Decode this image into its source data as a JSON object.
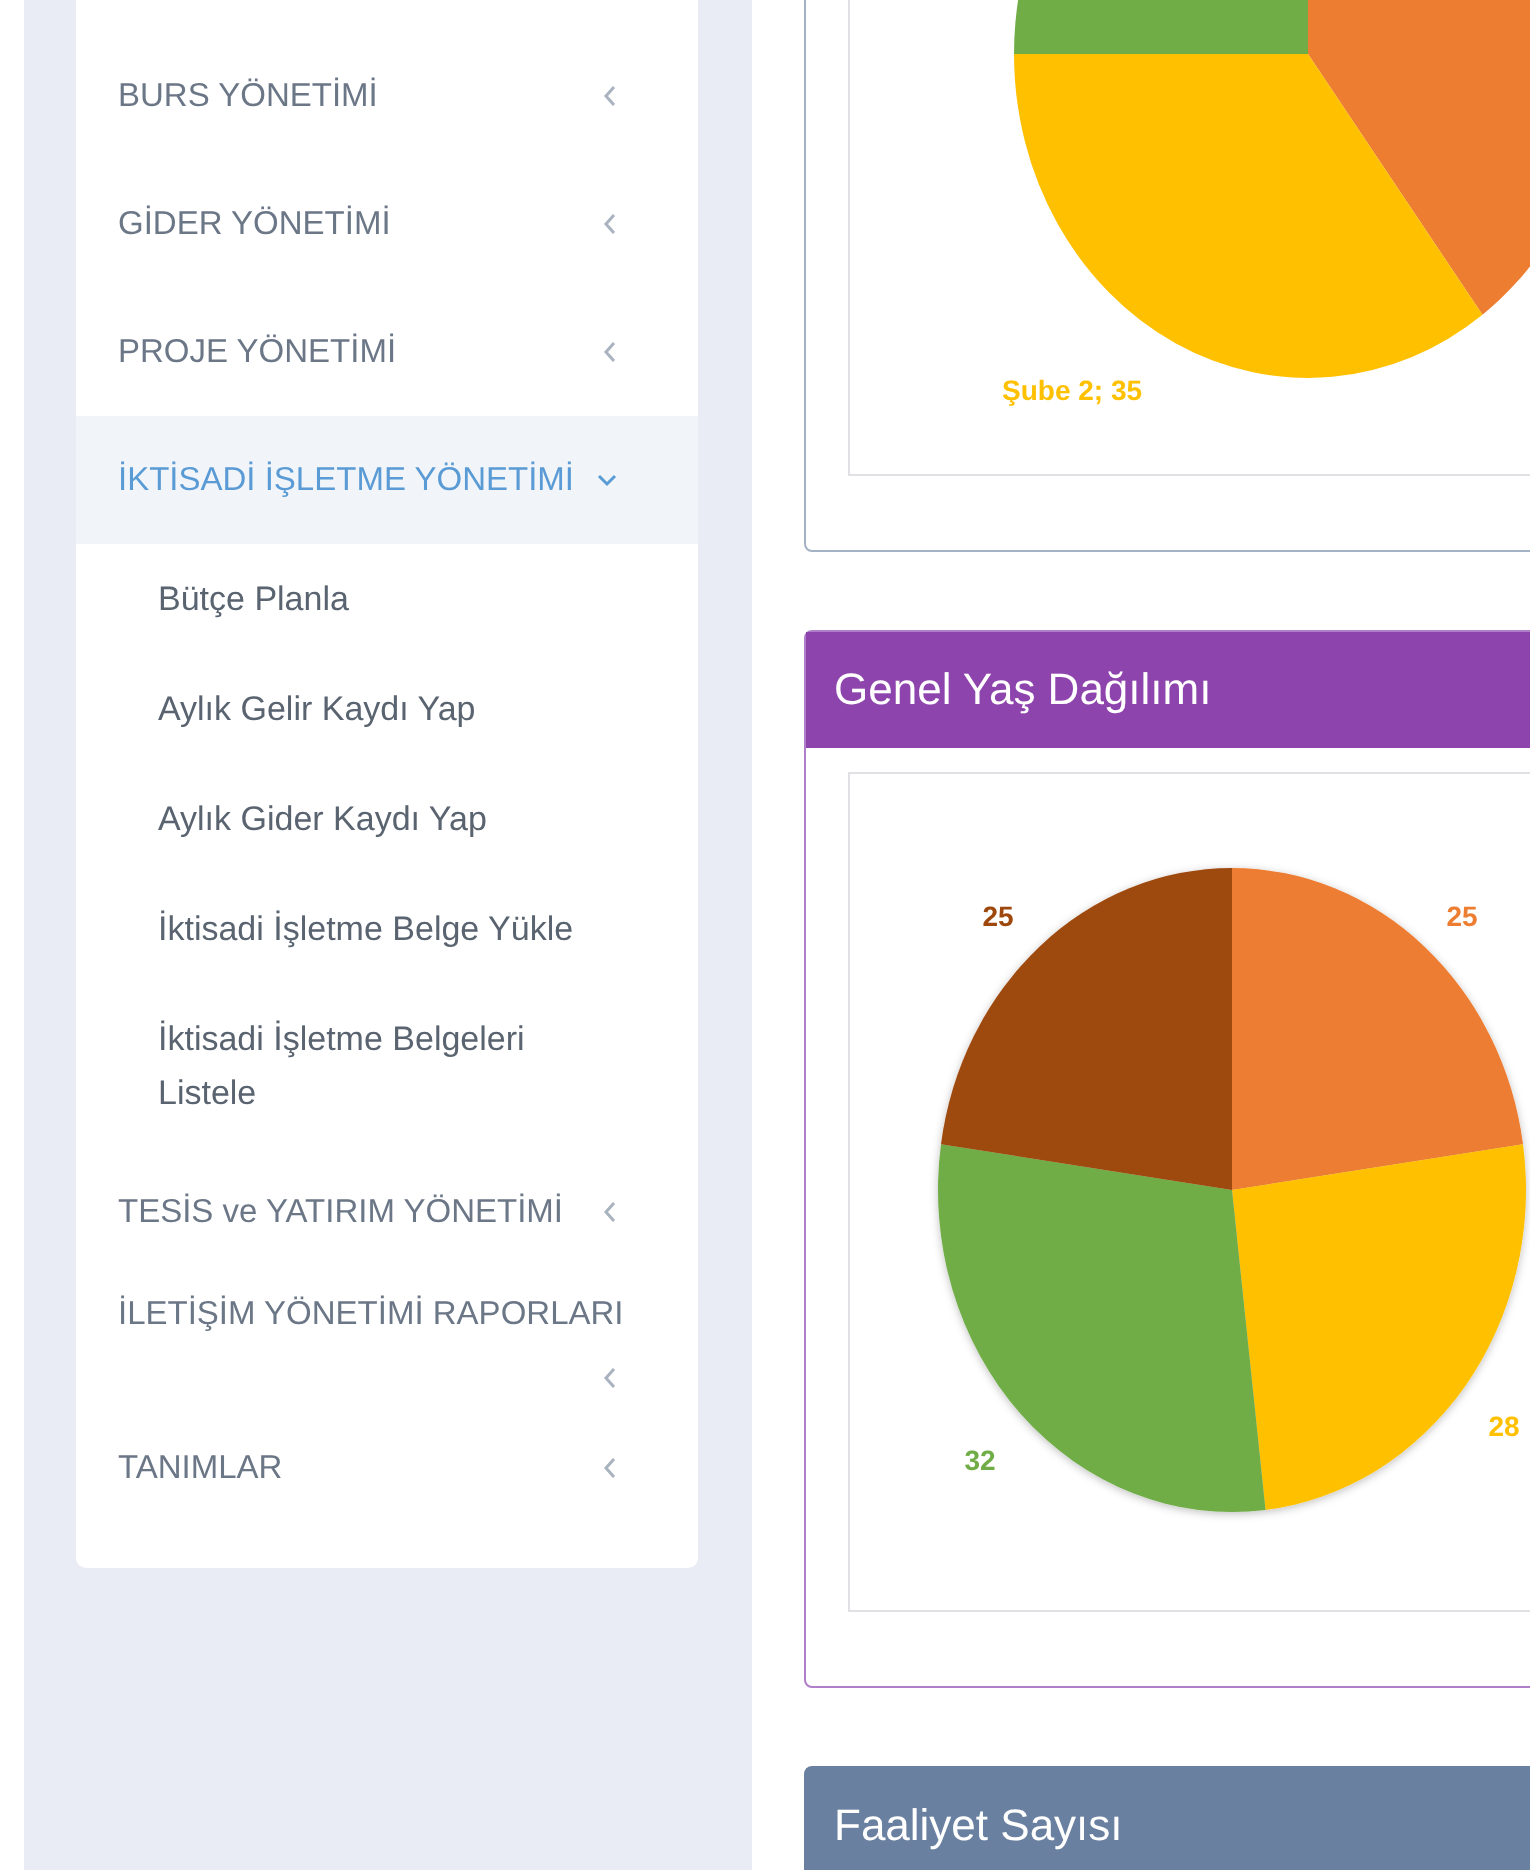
{
  "sidebar": {
    "items": [
      {
        "label": "BURS YÖNETİMİ",
        "expanded": false
      },
      {
        "label": "GİDER YÖNETİMİ",
        "expanded": false
      },
      {
        "label": "PROJE YÖNETİMİ",
        "expanded": false
      },
      {
        "label": "İKTİSADİ İŞLETME YÖNETİMİ",
        "expanded": true,
        "children": [
          {
            "label": "Bütçe Planla"
          },
          {
            "label": "Aylık Gelir Kaydı Yap"
          },
          {
            "label": "Aylık Gider Kaydı Yap"
          },
          {
            "label": "İktisadi İşletme Belge Yükle"
          },
          {
            "label": "İktisadi İşletme Belgeleri Listele"
          }
        ]
      },
      {
        "label": "TESİS ve YATIRIM YÖNETİMİ",
        "expanded": false
      },
      {
        "label": "İLETİŞİM YÖNETİMİ RAPORLARI",
        "expanded": false
      },
      {
        "label": "TANIMLAR",
        "expanded": false
      }
    ]
  },
  "panels": [
    {
      "kind": "pie_partial",
      "slice_label": "Şube 2; 35"
    },
    {
      "kind": "pie",
      "title": "Genel Yaş Dağılımı",
      "chart_data": {
        "type": "pie",
        "values": [
          25,
          28,
          32,
          25
        ],
        "data_labels": true
      }
    },
    {
      "kind": "header_only",
      "title": "Faaliyet Sayısı"
    }
  ]
}
